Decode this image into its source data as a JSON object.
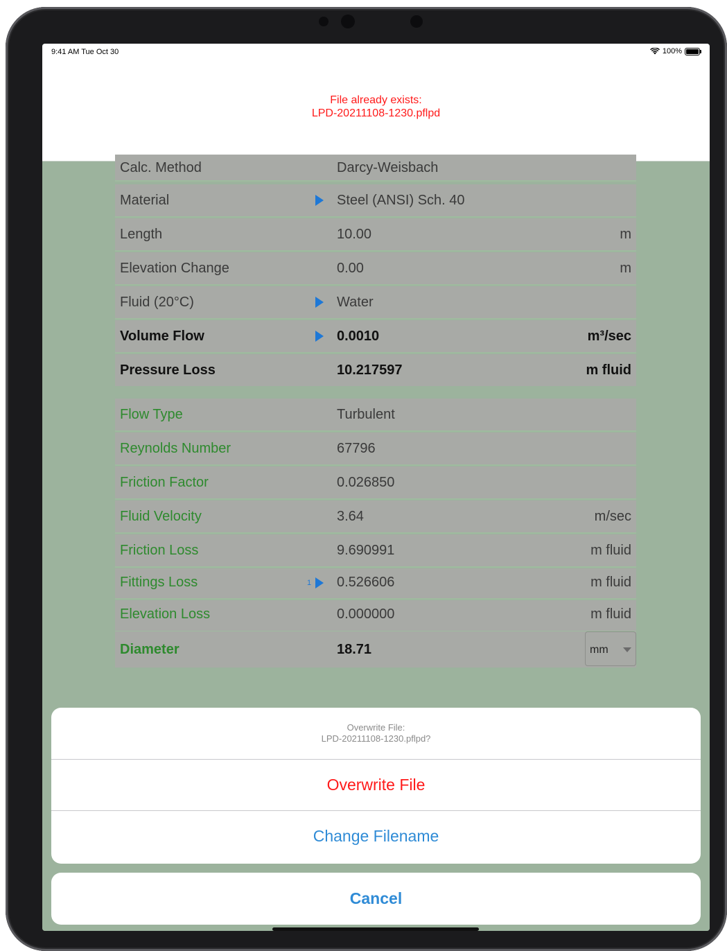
{
  "status": {
    "time": "9:41 AM  Tue Oct 30",
    "battery": "100%"
  },
  "header": {
    "alert_line1": "File already exists:",
    "alert_line2": "LPD-20211108-1230.pflpd"
  },
  "inputs": [
    {
      "label": "Calc. Method",
      "value": "Darcy-Weisbach",
      "unit": "",
      "arrow": false
    },
    {
      "label": "Material",
      "value": "Steel (ANSI) Sch.  40",
      "unit": "",
      "arrow": true
    },
    {
      "label": "Length",
      "value": "10.00",
      "unit": "m",
      "arrow": false
    },
    {
      "label": "Elevation Change",
      "value": "0.00",
      "unit": "m",
      "arrow": false
    },
    {
      "label": "Fluid (20°C)",
      "value": "Water",
      "unit": "",
      "arrow": true
    },
    {
      "label": "Volume Flow",
      "value": "0.0010",
      "unit": "m³/sec",
      "arrow": true
    },
    {
      "label": "Pressure Loss",
      "value": "10.217597",
      "unit": "m fluid",
      "arrow": false
    }
  ],
  "results": [
    {
      "label": "Flow Type",
      "value": "Turbulent",
      "unit": ""
    },
    {
      "label": "Reynolds Number",
      "value": "67796",
      "unit": ""
    },
    {
      "label": "Friction Factor",
      "value": "0.026850",
      "unit": ""
    },
    {
      "label": "Fluid Velocity",
      "value": "3.64",
      "unit": "m/sec"
    },
    {
      "label": "Friction Loss",
      "value": "9.690991",
      "unit": "m fluid"
    },
    {
      "label": "Fittings Loss",
      "value": "0.526606",
      "unit": "m fluid",
      "badge": "1"
    },
    {
      "label": "Elevation Loss",
      "value": "0.000000",
      "unit": "m fluid"
    },
    {
      "label": "Diameter",
      "value": "18.71",
      "unit_select": "mm"
    }
  ],
  "sheet": {
    "message_line1": "Overwrite File:",
    "message_line2": "LPD-20211108-1230.pflpd?",
    "overwrite_label": "Overwrite File",
    "change_label": "Change Filename",
    "cancel_label": "Cancel"
  },
  "colors": {
    "background": "#9cb39d",
    "destructive": "#ff1a1a",
    "accent": "#2f8bd6",
    "result_label": "#2e8a2e"
  }
}
